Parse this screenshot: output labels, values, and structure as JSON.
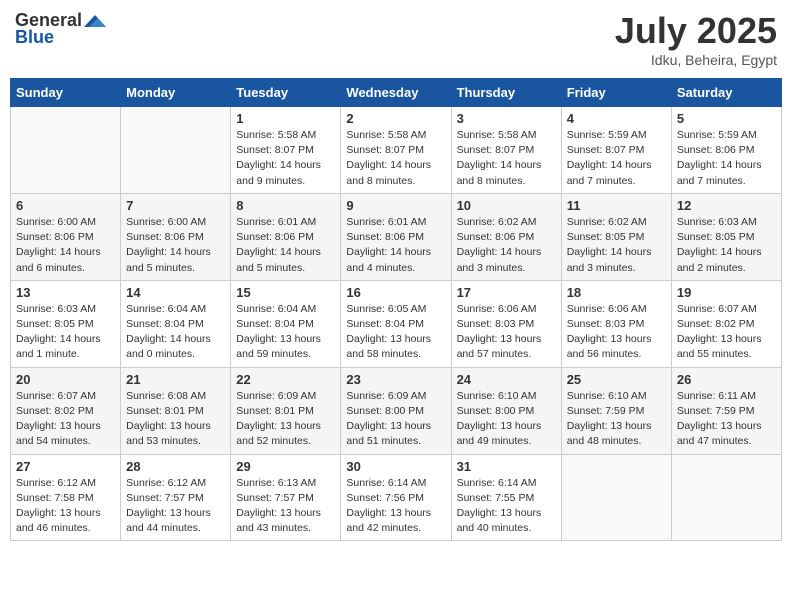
{
  "header": {
    "logo_general": "General",
    "logo_blue": "Blue",
    "month_title": "July 2025",
    "location": "Idku, Beheira, Egypt"
  },
  "weekdays": [
    "Sunday",
    "Monday",
    "Tuesday",
    "Wednesday",
    "Thursday",
    "Friday",
    "Saturday"
  ],
  "weeks": [
    [
      {
        "day": "",
        "sunrise": "",
        "sunset": "",
        "daylight": ""
      },
      {
        "day": "",
        "sunrise": "",
        "sunset": "",
        "daylight": ""
      },
      {
        "day": "1",
        "sunrise": "Sunrise: 5:58 AM",
        "sunset": "Sunset: 8:07 PM",
        "daylight": "Daylight: 14 hours and 9 minutes."
      },
      {
        "day": "2",
        "sunrise": "Sunrise: 5:58 AM",
        "sunset": "Sunset: 8:07 PM",
        "daylight": "Daylight: 14 hours and 8 minutes."
      },
      {
        "day": "3",
        "sunrise": "Sunrise: 5:58 AM",
        "sunset": "Sunset: 8:07 PM",
        "daylight": "Daylight: 14 hours and 8 minutes."
      },
      {
        "day": "4",
        "sunrise": "Sunrise: 5:59 AM",
        "sunset": "Sunset: 8:07 PM",
        "daylight": "Daylight: 14 hours and 7 minutes."
      },
      {
        "day": "5",
        "sunrise": "Sunrise: 5:59 AM",
        "sunset": "Sunset: 8:06 PM",
        "daylight": "Daylight: 14 hours and 7 minutes."
      }
    ],
    [
      {
        "day": "6",
        "sunrise": "Sunrise: 6:00 AM",
        "sunset": "Sunset: 8:06 PM",
        "daylight": "Daylight: 14 hours and 6 minutes."
      },
      {
        "day": "7",
        "sunrise": "Sunrise: 6:00 AM",
        "sunset": "Sunset: 8:06 PM",
        "daylight": "Daylight: 14 hours and 5 minutes."
      },
      {
        "day": "8",
        "sunrise": "Sunrise: 6:01 AM",
        "sunset": "Sunset: 8:06 PM",
        "daylight": "Daylight: 14 hours and 5 minutes."
      },
      {
        "day": "9",
        "sunrise": "Sunrise: 6:01 AM",
        "sunset": "Sunset: 8:06 PM",
        "daylight": "Daylight: 14 hours and 4 minutes."
      },
      {
        "day": "10",
        "sunrise": "Sunrise: 6:02 AM",
        "sunset": "Sunset: 8:06 PM",
        "daylight": "Daylight: 14 hours and 3 minutes."
      },
      {
        "day": "11",
        "sunrise": "Sunrise: 6:02 AM",
        "sunset": "Sunset: 8:05 PM",
        "daylight": "Daylight: 14 hours and 3 minutes."
      },
      {
        "day": "12",
        "sunrise": "Sunrise: 6:03 AM",
        "sunset": "Sunset: 8:05 PM",
        "daylight": "Daylight: 14 hours and 2 minutes."
      }
    ],
    [
      {
        "day": "13",
        "sunrise": "Sunrise: 6:03 AM",
        "sunset": "Sunset: 8:05 PM",
        "daylight": "Daylight: 14 hours and 1 minute."
      },
      {
        "day": "14",
        "sunrise": "Sunrise: 6:04 AM",
        "sunset": "Sunset: 8:04 PM",
        "daylight": "Daylight: 14 hours and 0 minutes."
      },
      {
        "day": "15",
        "sunrise": "Sunrise: 6:04 AM",
        "sunset": "Sunset: 8:04 PM",
        "daylight": "Daylight: 13 hours and 59 minutes."
      },
      {
        "day": "16",
        "sunrise": "Sunrise: 6:05 AM",
        "sunset": "Sunset: 8:04 PM",
        "daylight": "Daylight: 13 hours and 58 minutes."
      },
      {
        "day": "17",
        "sunrise": "Sunrise: 6:06 AM",
        "sunset": "Sunset: 8:03 PM",
        "daylight": "Daylight: 13 hours and 57 minutes."
      },
      {
        "day": "18",
        "sunrise": "Sunrise: 6:06 AM",
        "sunset": "Sunset: 8:03 PM",
        "daylight": "Daylight: 13 hours and 56 minutes."
      },
      {
        "day": "19",
        "sunrise": "Sunrise: 6:07 AM",
        "sunset": "Sunset: 8:02 PM",
        "daylight": "Daylight: 13 hours and 55 minutes."
      }
    ],
    [
      {
        "day": "20",
        "sunrise": "Sunrise: 6:07 AM",
        "sunset": "Sunset: 8:02 PM",
        "daylight": "Daylight: 13 hours and 54 minutes."
      },
      {
        "day": "21",
        "sunrise": "Sunrise: 6:08 AM",
        "sunset": "Sunset: 8:01 PM",
        "daylight": "Daylight: 13 hours and 53 minutes."
      },
      {
        "day": "22",
        "sunrise": "Sunrise: 6:09 AM",
        "sunset": "Sunset: 8:01 PM",
        "daylight": "Daylight: 13 hours and 52 minutes."
      },
      {
        "day": "23",
        "sunrise": "Sunrise: 6:09 AM",
        "sunset": "Sunset: 8:00 PM",
        "daylight": "Daylight: 13 hours and 51 minutes."
      },
      {
        "day": "24",
        "sunrise": "Sunrise: 6:10 AM",
        "sunset": "Sunset: 8:00 PM",
        "daylight": "Daylight: 13 hours and 49 minutes."
      },
      {
        "day": "25",
        "sunrise": "Sunrise: 6:10 AM",
        "sunset": "Sunset: 7:59 PM",
        "daylight": "Daylight: 13 hours and 48 minutes."
      },
      {
        "day": "26",
        "sunrise": "Sunrise: 6:11 AM",
        "sunset": "Sunset: 7:59 PM",
        "daylight": "Daylight: 13 hours and 47 minutes."
      }
    ],
    [
      {
        "day": "27",
        "sunrise": "Sunrise: 6:12 AM",
        "sunset": "Sunset: 7:58 PM",
        "daylight": "Daylight: 13 hours and 46 minutes."
      },
      {
        "day": "28",
        "sunrise": "Sunrise: 6:12 AM",
        "sunset": "Sunset: 7:57 PM",
        "daylight": "Daylight: 13 hours and 44 minutes."
      },
      {
        "day": "29",
        "sunrise": "Sunrise: 6:13 AM",
        "sunset": "Sunset: 7:57 PM",
        "daylight": "Daylight: 13 hours and 43 minutes."
      },
      {
        "day": "30",
        "sunrise": "Sunrise: 6:14 AM",
        "sunset": "Sunset: 7:56 PM",
        "daylight": "Daylight: 13 hours and 42 minutes."
      },
      {
        "day": "31",
        "sunrise": "Sunrise: 6:14 AM",
        "sunset": "Sunset: 7:55 PM",
        "daylight": "Daylight: 13 hours and 40 minutes."
      },
      {
        "day": "",
        "sunrise": "",
        "sunset": "",
        "daylight": ""
      },
      {
        "day": "",
        "sunrise": "",
        "sunset": "",
        "daylight": ""
      }
    ]
  ]
}
